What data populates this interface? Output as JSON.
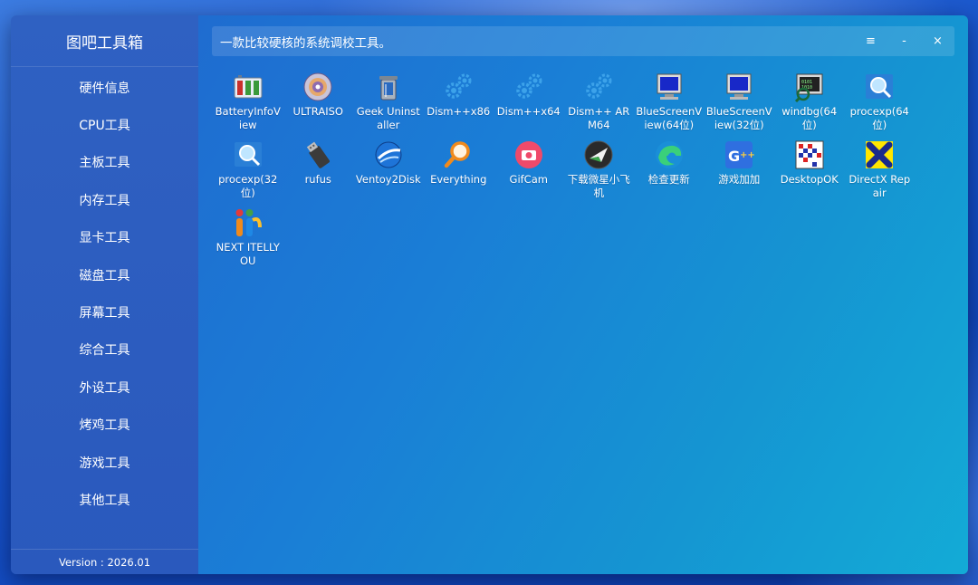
{
  "app": {
    "title": "图吧工具箱",
    "version": "Version : 2026.01",
    "slogan": "一款比较硬核的系统调校工具。"
  },
  "window_controls": {
    "menu": "≡",
    "minimize": "-",
    "close": "×"
  },
  "sidebar": {
    "items": [
      {
        "label": "硬件信息"
      },
      {
        "label": "CPU工具"
      },
      {
        "label": "主板工具"
      },
      {
        "label": "内存工具"
      },
      {
        "label": "显卡工具"
      },
      {
        "label": "磁盘工具"
      },
      {
        "label": "屏幕工具"
      },
      {
        "label": "综合工具"
      },
      {
        "label": "外设工具"
      },
      {
        "label": "烤鸡工具"
      },
      {
        "label": "游戏工具"
      },
      {
        "label": "其他工具"
      }
    ]
  },
  "tools": [
    {
      "label": "BatteryInfoView",
      "icon": "battery-icon"
    },
    {
      "label": "ULTRAISO",
      "icon": "disc-icon"
    },
    {
      "label": "Geek Uninstaller",
      "icon": "trash-can-icon"
    },
    {
      "label": "Dism++x86",
      "icon": "gears-icon"
    },
    {
      "label": "Dism++x64",
      "icon": "gears-icon"
    },
    {
      "label": "Dism++ ARM64",
      "icon": "gears-icon"
    },
    {
      "label": "BlueScreenView(64位)",
      "icon": "monitor-icon"
    },
    {
      "label": "BlueScreenView(32位)",
      "icon": "monitor-icon"
    },
    {
      "label": "windbg(64位)",
      "icon": "debugger-icon"
    },
    {
      "label": "procexp(64位)",
      "icon": "magnifier-window-icon"
    },
    {
      "label": "procexp(32位)",
      "icon": "magnifier-window-icon"
    },
    {
      "label": "rufus",
      "icon": "usb-drive-icon"
    },
    {
      "label": "Ventoy2Disk",
      "icon": "ventoy-globe-icon"
    },
    {
      "label": "Everything",
      "icon": "search-magnifier-icon"
    },
    {
      "label": "GifCam",
      "icon": "camera-icon"
    },
    {
      "label": "下载微星小飞机",
      "icon": "afterburner-plane-icon"
    },
    {
      "label": "检查更新",
      "icon": "edge-browser-icon"
    },
    {
      "label": "游戏加加",
      "icon": "game-plus-icon"
    },
    {
      "label": "DesktopOK",
      "icon": "desktop-grid-icon"
    },
    {
      "label": "DirectX Repair",
      "icon": "directx-icon"
    },
    {
      "label": "NEXT ITELLYOU",
      "icon": "itellyou-logo-icon"
    }
  ]
}
